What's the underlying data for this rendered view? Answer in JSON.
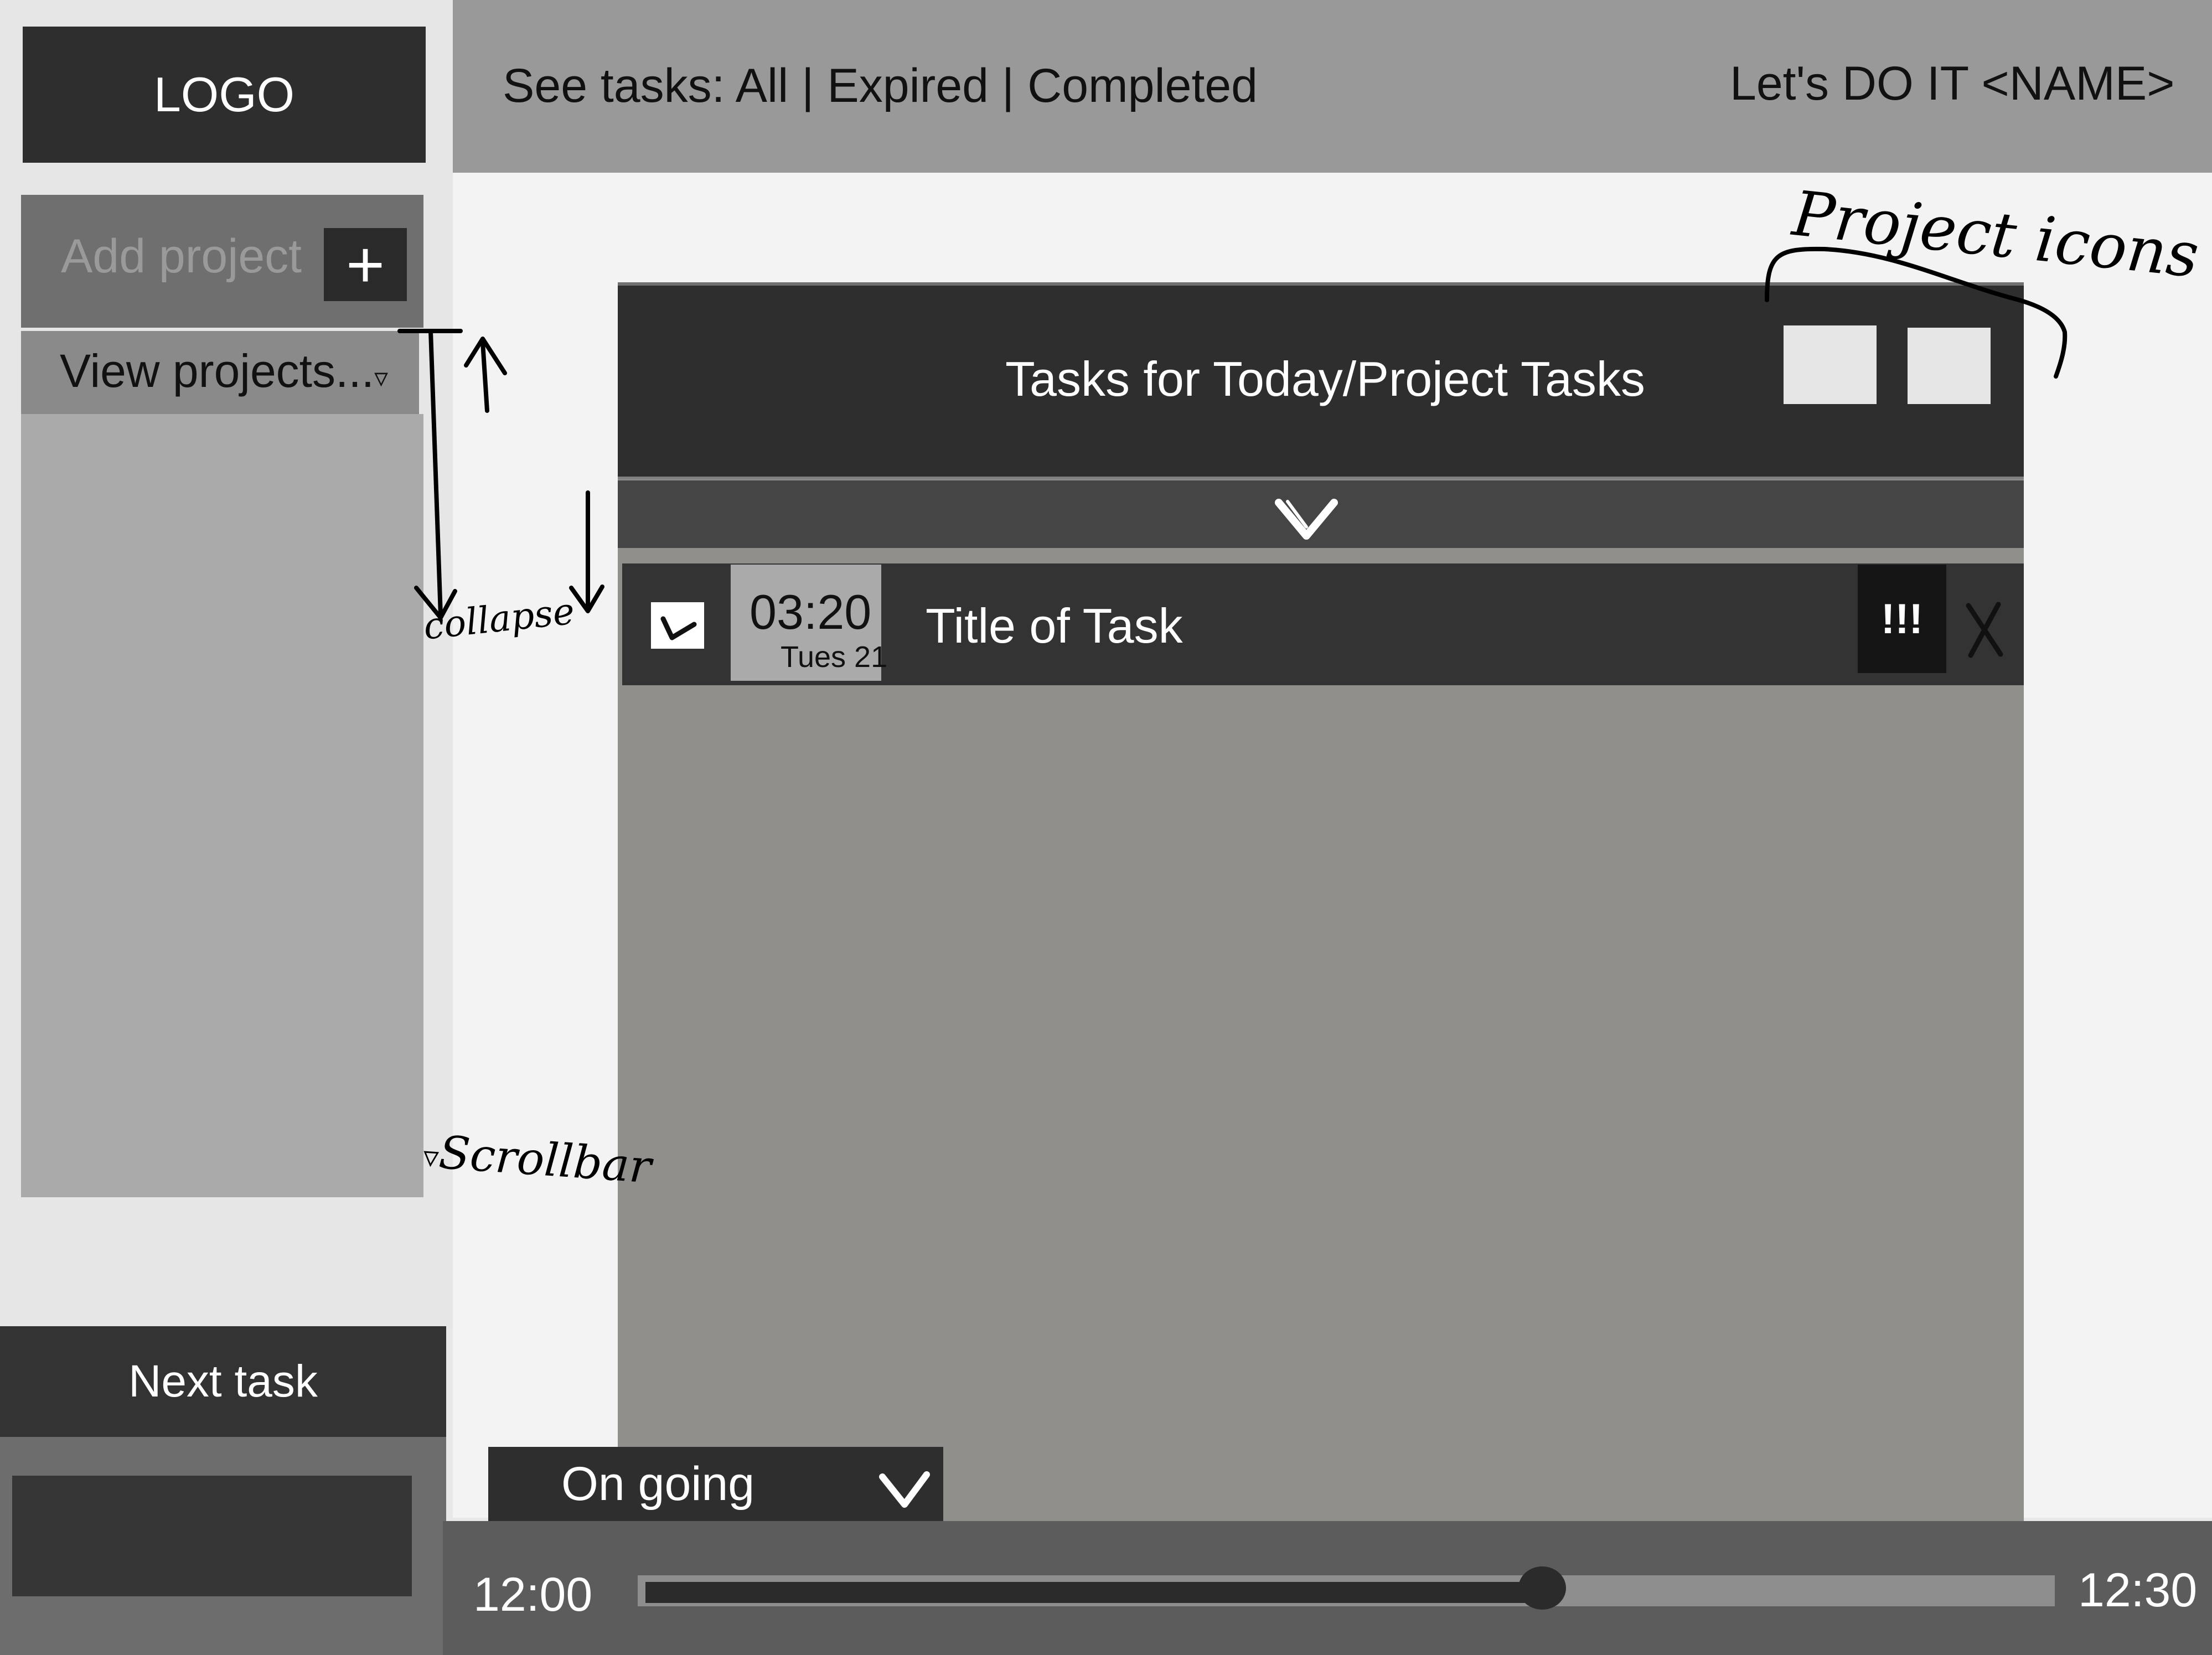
{
  "sidebar": {
    "logo_text": "LOGO",
    "add_project_label": "Add project",
    "add_project_button": "+",
    "view_projects_label": "View projects...",
    "view_projects_marker": "▿"
  },
  "next_task": {
    "title": "Next task"
  },
  "header": {
    "filters": "See tasks: All | Expired | Completed",
    "greeting": "Let's DO IT <NAME>"
  },
  "panel": {
    "title": "Tasks for Today/Project Tasks"
  },
  "tasks": [
    {
      "checked": true,
      "check_glyph": "✓",
      "time": "03:20",
      "date": "Tues 21",
      "title": "Title of Task",
      "priority": "!!!",
      "delete_glyph": "X"
    }
  ],
  "status": {
    "selected": "On going"
  },
  "timeline": {
    "start": "12:00",
    "end": "12:30",
    "progress": 0.64
  },
  "annotations": {
    "project_icons": "Project icons",
    "collapse": "collapse",
    "scrollbar": "Scrollbar",
    "scrollbar_marker": "▿"
  },
  "icons": {
    "add_project": "plus-icon",
    "collapse": "chevron-down-icon",
    "status": "chevron-down-icon",
    "task_check": "checkmark-icon",
    "delete": "close-icon"
  },
  "colors": {
    "dark": "#2e2e2e",
    "topbar": "#999999",
    "panel": "#918f8c",
    "content": "#f3f3f3"
  }
}
